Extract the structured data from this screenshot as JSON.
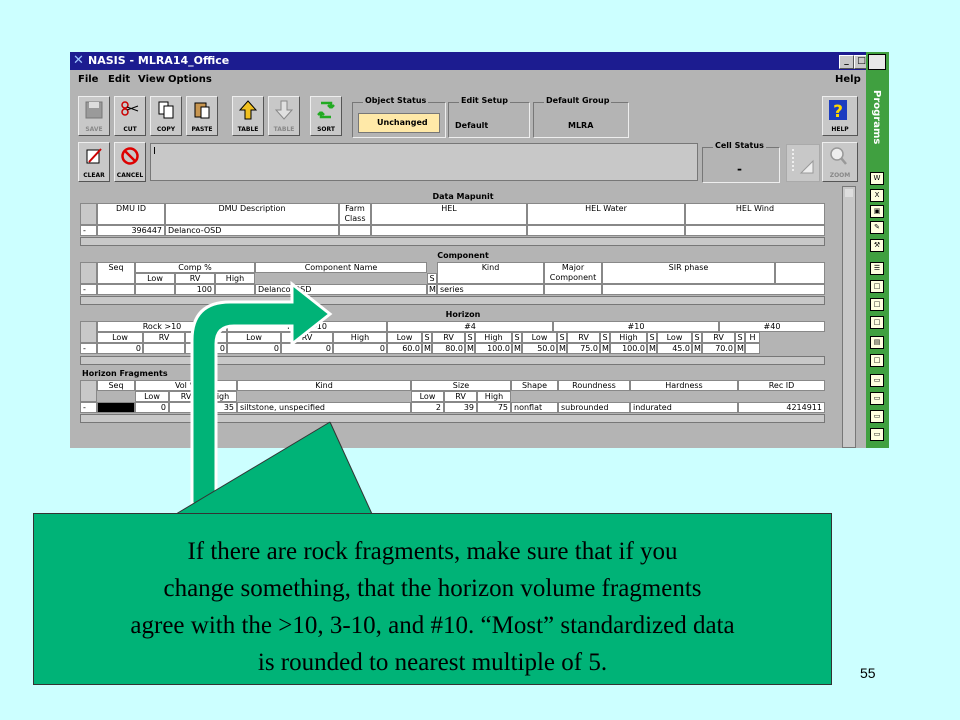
{
  "window": {
    "title": "NASIS - MLRA14_Office",
    "menu": [
      "File",
      "Edit",
      "View",
      "Options"
    ],
    "menu_help": "Help",
    "title_buttons": [
      "_",
      "□",
      "X"
    ]
  },
  "toolbar": {
    "tools": [
      {
        "label": "SAVE",
        "icon": "floppy-icon",
        "dim": true
      },
      {
        "label": "CUT",
        "icon": "scissors-icon"
      },
      {
        "label": "COPY",
        "icon": "copy-icon"
      },
      {
        "label": "PASTE",
        "icon": "paste-icon"
      },
      {
        "label": "TABLE",
        "icon": "up-arrow-icon"
      },
      {
        "label": "TABLE",
        "icon": "down-arrow-icon",
        "dim": true
      },
      {
        "label": "SORT",
        "icon": "sort-icon"
      }
    ],
    "object_status": {
      "label": "Object Status",
      "value": "Unchanged"
    },
    "edit_setup": {
      "label": "Edit Setup",
      "value": "Default"
    },
    "default_group": {
      "label": "Default Group",
      "value": "MLRA"
    },
    "help_label": "HELP",
    "clear_label": "CLEAR",
    "cancel_label": "CANCEL",
    "edit_text": "I",
    "cell_status": {
      "label": "Cell Status",
      "value": "-"
    },
    "zoom_label": "ZOOM"
  },
  "data_mapunit": {
    "title": "Data Mapunit",
    "headers": [
      "DMU ID",
      "DMU Description",
      "Farm Class",
      "HEL",
      "HEL Water",
      "HEL Wind"
    ],
    "row": {
      "marker": "-",
      "dmu_id": "396447",
      "dmu_desc": "Delanco-OSD"
    }
  },
  "component": {
    "title": "Component",
    "headers": {
      "seq": "Seq",
      "comp": "Comp %",
      "low": "Low",
      "rv": "RV",
      "high": "High",
      "name": "Component Name",
      "s": "S",
      "kind": "Kind",
      "major": "Major Component",
      "sir": "SIR phase"
    },
    "row": {
      "marker": "-",
      "rv": "100",
      "name": "Delanco-OSD",
      "s": "M",
      "kind": "series"
    }
  },
  "horizon": {
    "title": "Horizon",
    "groups": [
      "Rock >10",
      "Rock 3-10",
      "#4",
      "#10",
      "#40"
    ],
    "sub": [
      "Low",
      "RV",
      "High",
      "Low",
      "RV",
      "High",
      "Low",
      "S",
      "RV",
      "S",
      "High",
      "S",
      "Low",
      "S",
      "RV",
      "S",
      "High",
      "S",
      "Low",
      "S",
      "RV",
      "S",
      "H"
    ],
    "row": [
      "0",
      "",
      "0",
      "0",
      "0",
      "0",
      "60.0",
      "M",
      "80.0",
      "M",
      "100.0",
      "M",
      "50.0",
      "M",
      "75.0",
      "M",
      "100.0",
      "M",
      "45.0",
      "M",
      "70.0",
      "M",
      ""
    ]
  },
  "fragments": {
    "title": "Horizon Fragments",
    "headers": {
      "seq": "Seq",
      "vol": "Vol %",
      "low": "Low",
      "rv": "RV",
      "high": "High",
      "kind": "Kind",
      "size": "Size",
      "slow": "Low",
      "srv": "RV",
      "shigh": "High",
      "shape": "Shape",
      "round": "Roundness",
      "hard": "Hardness",
      "rec": "Rec ID"
    },
    "row": {
      "marker": "-",
      "low": "0",
      "rv": "17",
      "high": "35",
      "kind": "siltstone, unspecified",
      "slow": "2",
      "srv": "39",
      "shigh": "75",
      "shape": "nonflat",
      "round": "subrounded",
      "hard": "indurated",
      "rec": "4214911"
    }
  },
  "sidebar": {
    "label": "Programs",
    "icons": [
      "W",
      "X",
      "▣",
      "✎",
      "⚒",
      "☰",
      "□",
      "□",
      "□",
      "▤",
      "□",
      "▭",
      "▭",
      "▭",
      "▭",
      "▭"
    ]
  },
  "callout": {
    "lines": [
      "If there are rock fragments, make sure that if you",
      "change something, that the horizon volume fragments",
      "agree with the >10, 3-10, and #10. “Most” standardized data",
      "is rounded to nearest multiple of 5."
    ]
  },
  "page_number": "55",
  "colors": {
    "background": "#ccffff",
    "callout": "#00b377",
    "titlebar": "#1c1c90",
    "sidebar": "#40a040"
  }
}
